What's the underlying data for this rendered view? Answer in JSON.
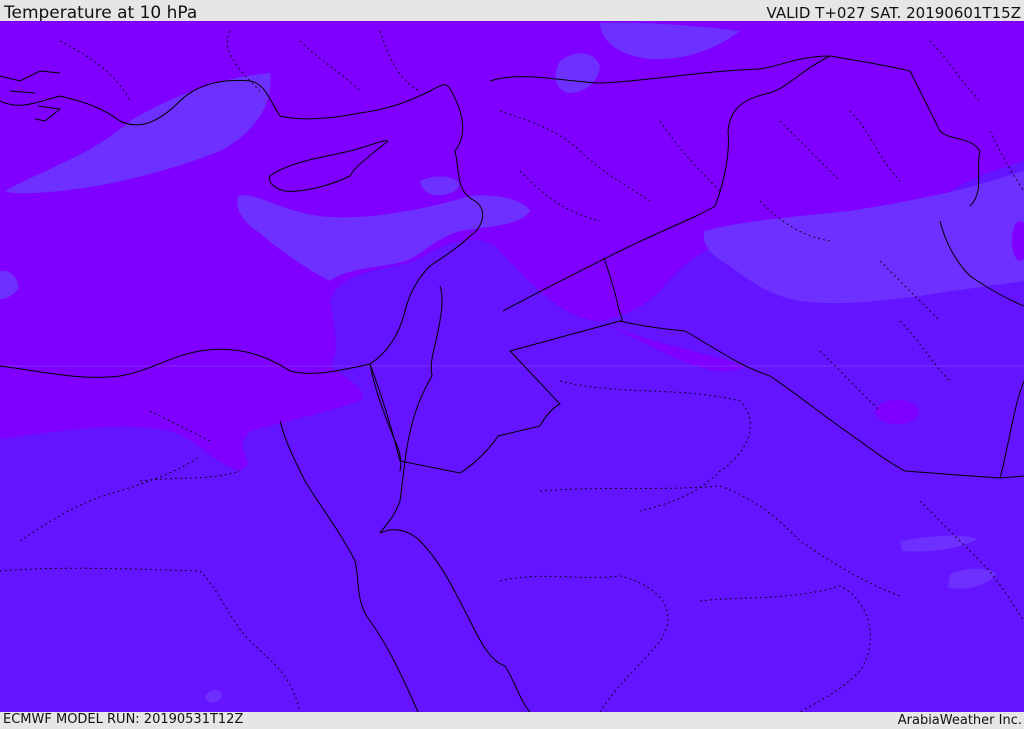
{
  "header": {
    "title": "Temperature at 10 hPa",
    "valid": "VALID T+027 SAT. 20190601T15Z"
  },
  "footer": {
    "model_run": "ECMWF MODEL RUN: 20190531T12Z",
    "credit": "ArabiaWeather Inc."
  },
  "map": {
    "colors": {
      "cold_band": "#7f00ff",
      "main_band": "#6414ff",
      "light_patch": "#6e30ff",
      "border": "#000000"
    }
  }
}
